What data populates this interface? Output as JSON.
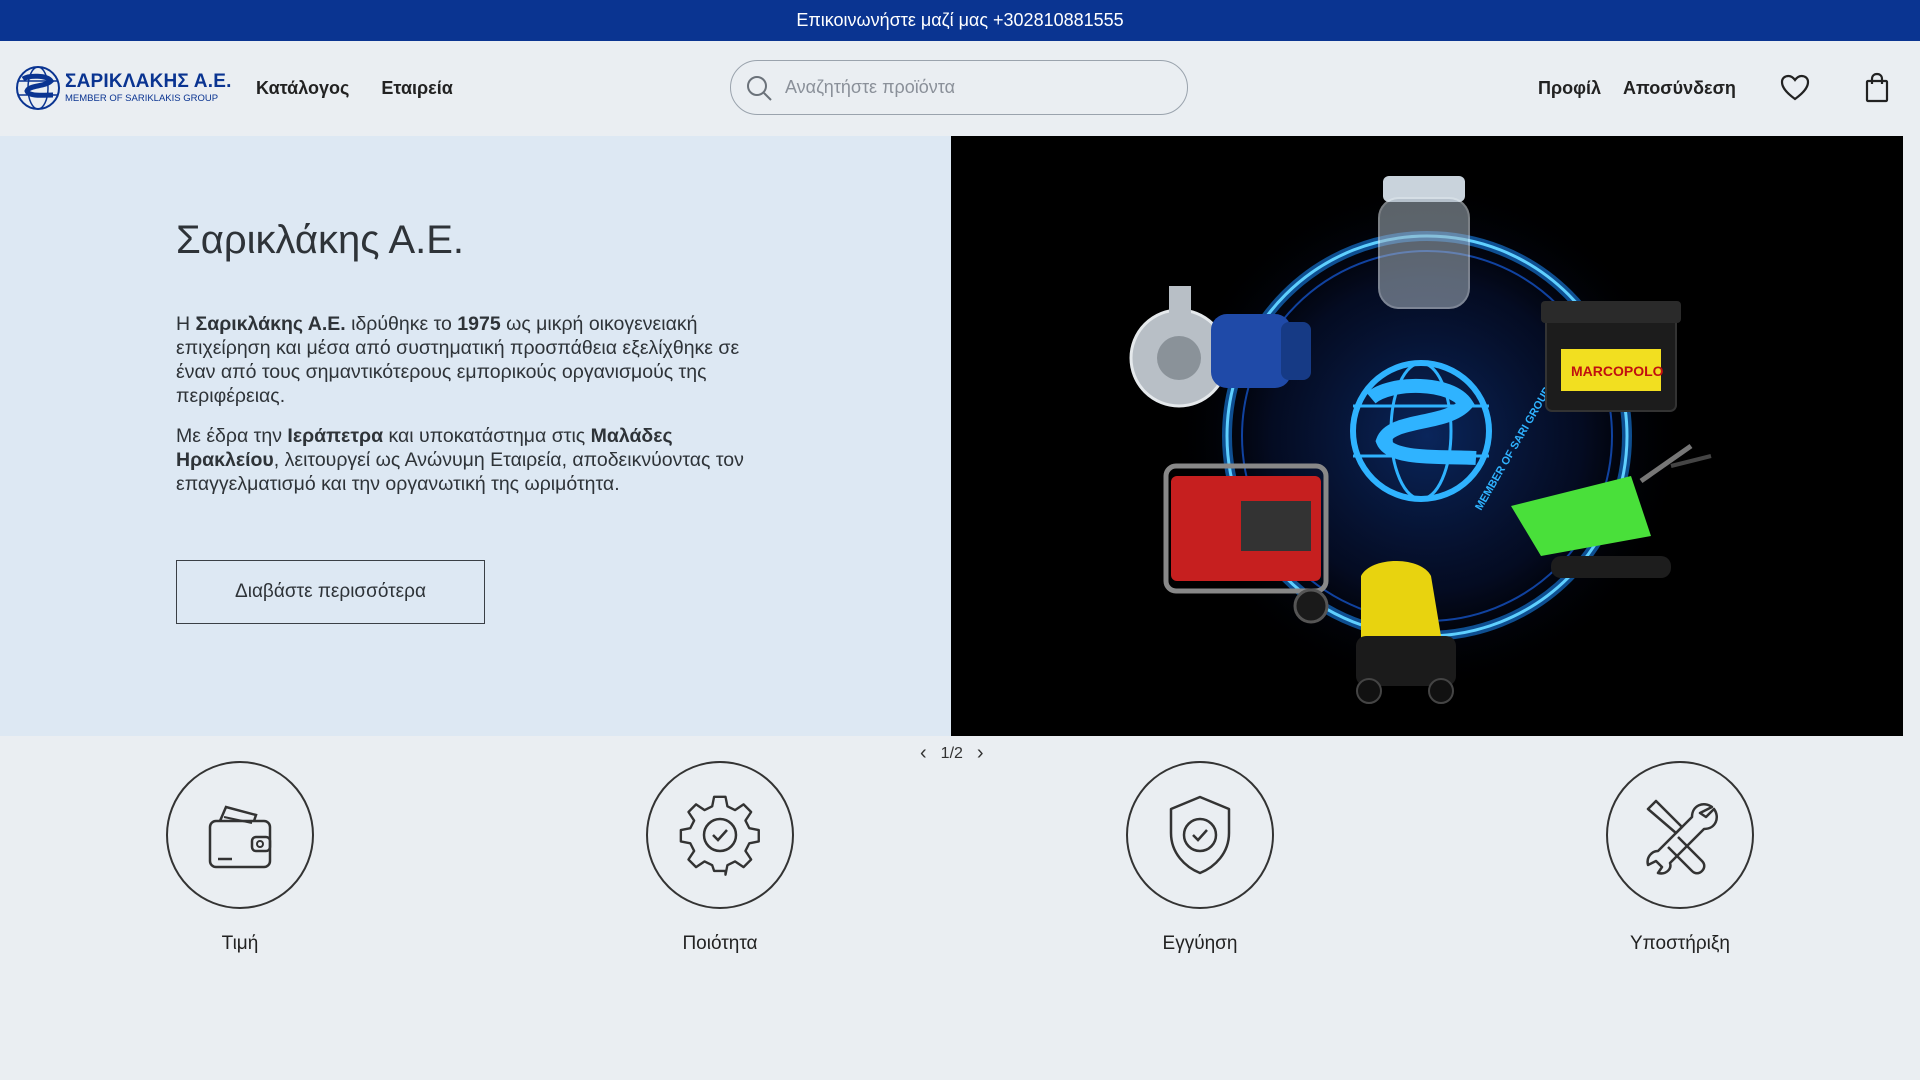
{
  "topbar": {
    "contact_text": "Επικοινωνήστε μαζί μας +302810881555"
  },
  "header": {
    "logo": {
      "title": "ΣΑΡΙΚΛΑΚΗΣ Α.Ε.",
      "subtitle": "MEMBER OF SARIKLAKIS GROUP"
    },
    "nav": [
      {
        "label": "Κατάλογος"
      },
      {
        "label": "Εταιρεία"
      }
    ],
    "search": {
      "placeholder": "Αναζητήστε προϊόντα",
      "value": ""
    },
    "account": {
      "profile_label": "Προφίλ",
      "logout_label": "Αποσύνδεση"
    },
    "icons": {
      "wishlist": "heart-icon",
      "cart": "shopping-bag-icon",
      "search": "search-icon"
    }
  },
  "hero": {
    "title": "Σαρικλάκης Α.Ε.",
    "paragraph1": {
      "t1": "Η ",
      "b1": "Σαρικλάκης Α.Ε.",
      "t2": " ιδρύθηκε το ",
      "b2": "1975",
      "t3": " ως μικρή οικογενειακή επιχείρηση και μέσα από συστηματική προσπάθεια εξελίχθηκε σε έναν από τους σημαντικότερους εμπορικούς οργανισμούς της περιφέρειας."
    },
    "paragraph2": {
      "t1": "Με έδρα την ",
      "b1": "Ιεράπετρα",
      "t2": " και υποκατάστημα στις ",
      "b2": "Μαλάδες Ηρακλείου",
      "t3": ", λειτουργεί ως Ανώνυμη Εταιρεία, αποδεικνύοντας τον επαγγελματισμό και την οργανωτική της ωριμότητα."
    },
    "button_label": "Διαβάστε περισσότερα",
    "image": {
      "badge_text": "MEMBER OF SARI GROUP",
      "battery_brand": "MARCOPOLO"
    }
  },
  "carousel": {
    "indicator": "1/2",
    "prev": "‹",
    "next": "›"
  },
  "features": [
    {
      "label": "Τιμή",
      "icon": "wallet-icon"
    },
    {
      "label": "Ποιότητα",
      "icon": "gear-check-icon"
    },
    {
      "label": "Εγγύηση",
      "icon": "shield-check-icon"
    },
    {
      "label": "Υποστήριξη",
      "icon": "tools-icon"
    }
  ],
  "colors": {
    "brand_blue": "#0a3491",
    "page_bg": "#eaeef2",
    "hero_bg": "#dde8f3",
    "glow": "#1aa8ff"
  }
}
